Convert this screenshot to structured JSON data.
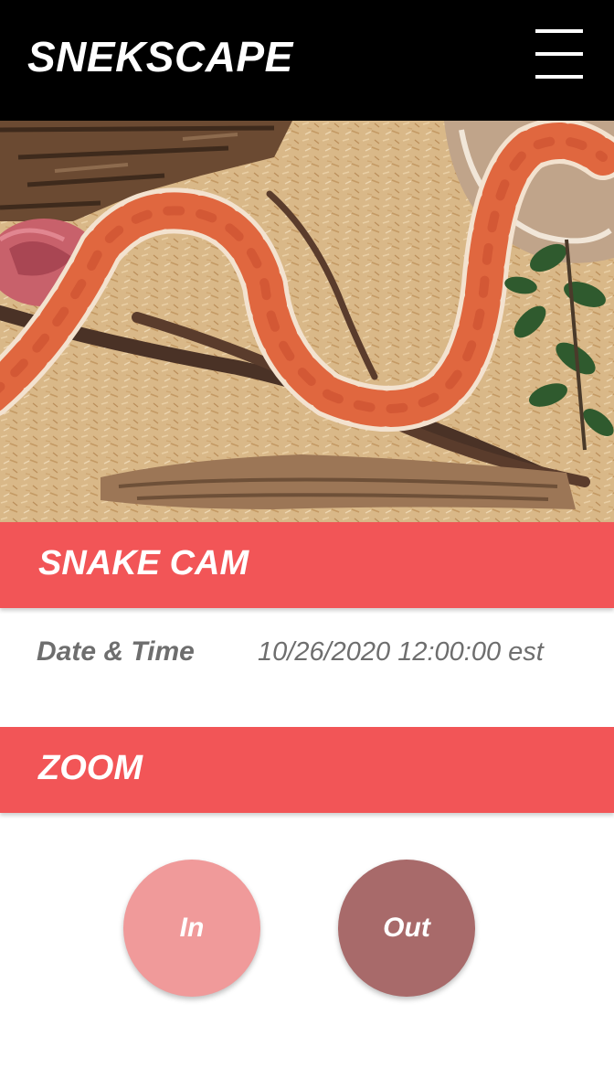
{
  "header": {
    "title": "SNEKSCAPE",
    "menu_icon": "hamburger-menu-icon"
  },
  "camera": {
    "feed_subject": "corn snake in terrarium"
  },
  "snake_cam": {
    "title": "SNAKE CAM",
    "date_label": "Date & Time",
    "date_value": "10/26/2020 12:00:00 est"
  },
  "zoom": {
    "title": "ZOOM",
    "in_label": "In",
    "out_label": "Out"
  },
  "colors": {
    "topbar": "#000000",
    "accent": "#f25557",
    "zoom_in": "#f09a9a",
    "zoom_out": "#a86a6a",
    "muted_text": "#6e6e6e"
  }
}
